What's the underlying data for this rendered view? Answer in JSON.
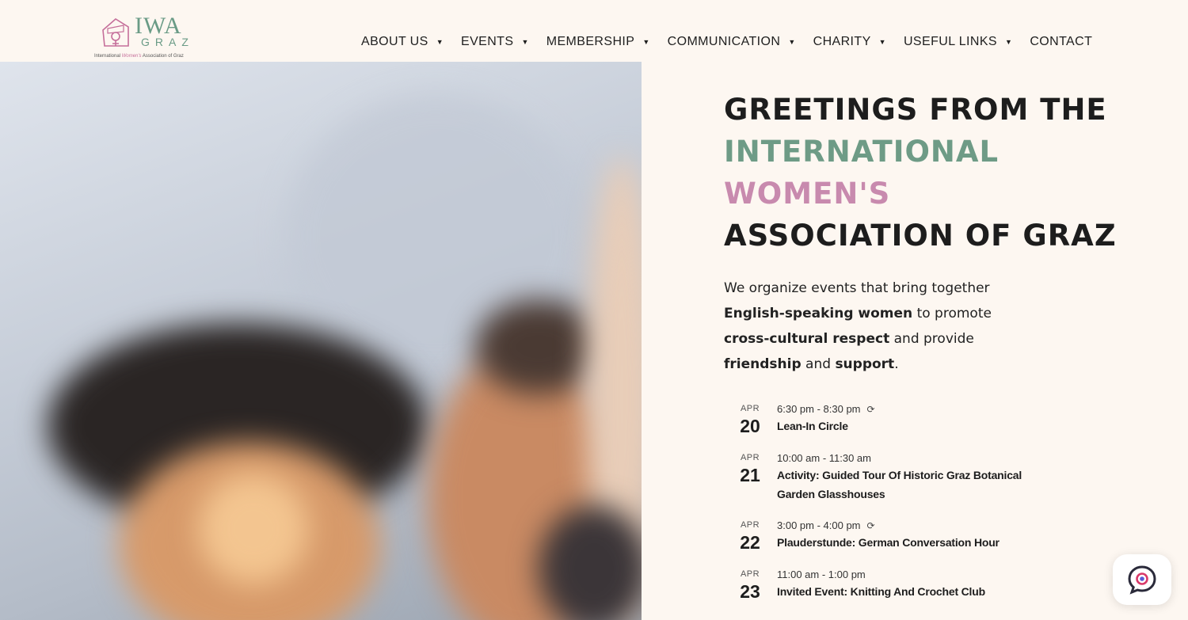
{
  "logo": {
    "word": "IWA",
    "sub": "GRAZ",
    "tagline_start": "International ",
    "tagline_accent": "Women's",
    "tagline_end": " Association of Graz"
  },
  "nav": {
    "items": [
      {
        "label": "ABOUT US",
        "has_dropdown": true
      },
      {
        "label": "EVENTS",
        "has_dropdown": true
      },
      {
        "label": "MEMBERSHIP",
        "has_dropdown": true
      },
      {
        "label": "COMMUNICATION",
        "has_dropdown": true
      },
      {
        "label": "CHARITY",
        "has_dropdown": true
      },
      {
        "label": "USEFUL LINKS",
        "has_dropdown": true
      },
      {
        "label": "CONTACT",
        "has_dropdown": false
      }
    ],
    "caret": "▼"
  },
  "hero": {
    "title_line1": "GREETINGS FROM THE",
    "title_line2": "INTERNATIONAL",
    "title_line3": "WOMEN'S",
    "title_line4": "ASSOCIATION OF GRAZ",
    "intro": {
      "p1": "We organize events that bring together ",
      "b1": "English-speaking women",
      "p2": " to promote ",
      "b2": "cross-cultural respect",
      "p3": " and provide ",
      "b3": "friendship",
      "p4": " and ",
      "b4": "support",
      "p5": "."
    }
  },
  "events": [
    {
      "month": "APR",
      "day": "20",
      "time": "6:30 pm - 8:30 pm",
      "recurring": true,
      "title": "Lean-In Circle"
    },
    {
      "month": "APR",
      "day": "21",
      "time": "10:00 am - 11:30 am",
      "recurring": false,
      "title": "Activity: Guided Tour Of Historic Graz Botanical Garden Glasshouses"
    },
    {
      "month": "APR",
      "day": "22",
      "time": "3:00 pm - 4:00 pm",
      "recurring": true,
      "title": "Plauderstunde: German Conversation Hour"
    },
    {
      "month": "APR",
      "day": "23",
      "time": "11:00 am - 1:00 pm",
      "recurring": false,
      "title": "Invited Event: Knitting And Crochet Club"
    }
  ],
  "icons": {
    "recurring": "repeat-icon",
    "chat": "chat-icon"
  },
  "colors": {
    "background": "#fdf7f1",
    "green": "#6e9b86",
    "pink": "#c88aae",
    "dark": "#1d1d1d",
    "chat_accent": "#d93a6a"
  }
}
